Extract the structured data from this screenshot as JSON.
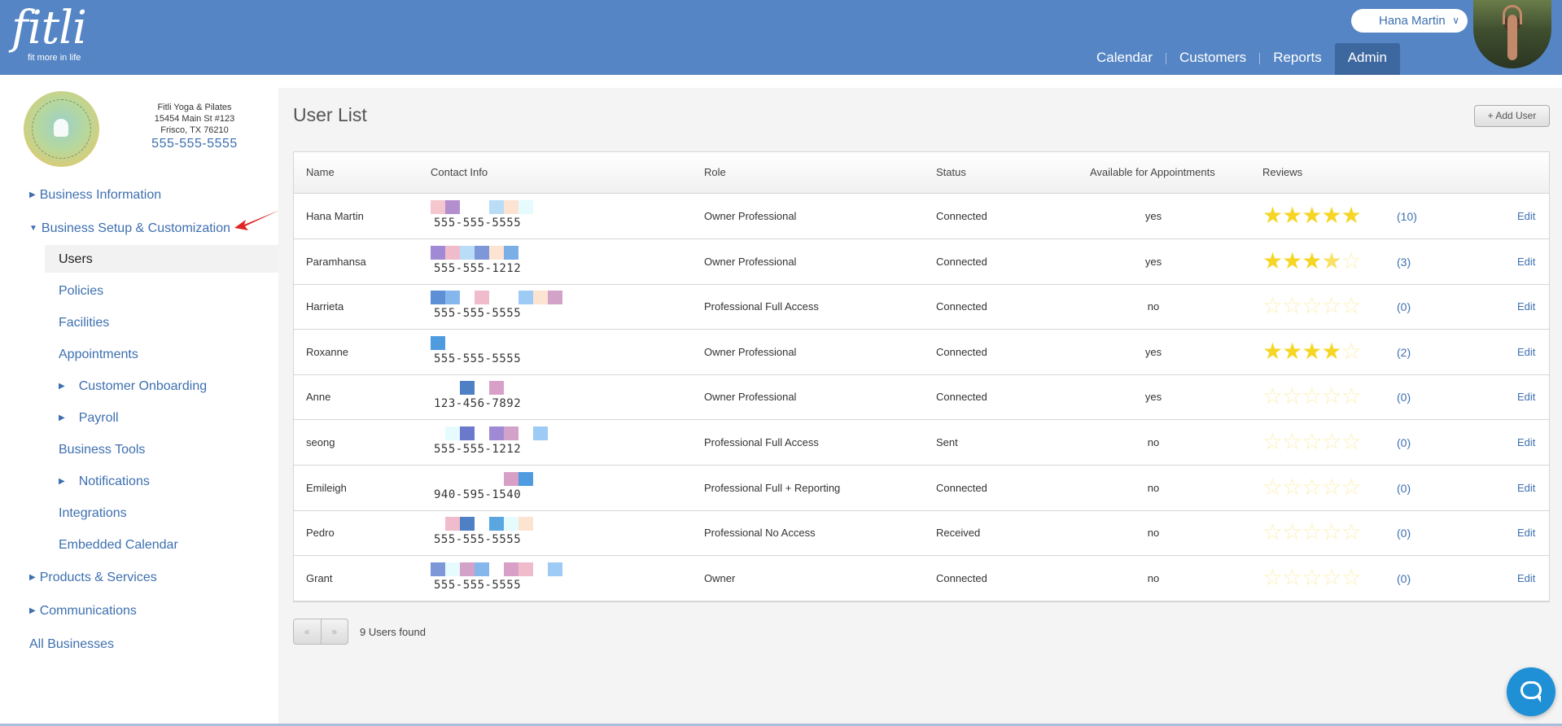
{
  "app": {
    "logo": "fitli",
    "tagline": "fit more in life"
  },
  "header": {
    "user_name": "Hana Martin",
    "nav": [
      {
        "label": "Calendar"
      },
      {
        "label": "Customers"
      },
      {
        "label": "Reports"
      },
      {
        "label": "Admin",
        "active": true
      }
    ]
  },
  "business": {
    "name": "Fitli Yoga & Pilates",
    "address1": "15454 Main St #123",
    "address2": "Frisco, TX 76210",
    "phone": "555-555-5555"
  },
  "sidebar": {
    "items": [
      {
        "label": "Business Information"
      },
      {
        "label": "Business Setup & Customization"
      },
      {
        "label": "Users"
      },
      {
        "label": "Policies"
      },
      {
        "label": "Facilities"
      },
      {
        "label": "Appointments"
      },
      {
        "label": "Customer Onboarding"
      },
      {
        "label": "Payroll"
      },
      {
        "label": "Business Tools"
      },
      {
        "label": "Notifications"
      },
      {
        "label": "Integrations"
      },
      {
        "label": "Embedded Calendar"
      },
      {
        "label": "Products & Services"
      },
      {
        "label": "Communications"
      },
      {
        "label": "All Businesses"
      }
    ]
  },
  "main": {
    "title": "User List",
    "add_button": "+ Add User",
    "columns": {
      "name": "Name",
      "contact": "Contact Info",
      "role": "Role",
      "status": "Status",
      "available": "Available for Appointments",
      "reviews": "Reviews"
    },
    "edit_label": "Edit",
    "rows": [
      {
        "name": "Hana Martin",
        "phone": "555-555-5555",
        "role": "Owner Professional",
        "status": "Connected",
        "available": "yes",
        "rating": 5,
        "review_count": "(10)"
      },
      {
        "name": "Paramhansa",
        "phone": "555-555-1212",
        "role": "Owner Professional",
        "status": "Connected",
        "available": "yes",
        "rating": 3.5,
        "review_count": "(3)"
      },
      {
        "name": "Harrieta",
        "phone": "555-555-5555",
        "role": "Professional Full Access",
        "status": "Connected",
        "available": "no",
        "rating": 0,
        "review_count": "(0)"
      },
      {
        "name": "Roxanne",
        "phone": "555-555-5555",
        "role": "Owner Professional",
        "status": "Connected",
        "available": "yes",
        "rating": 4,
        "review_count": "(2)"
      },
      {
        "name": "Anne",
        "phone": "123-456-7892",
        "role": "Owner Professional",
        "status": "Connected",
        "available": "yes",
        "rating": 0,
        "review_count": "(0)"
      },
      {
        "name": "seong",
        "phone": "555-555-1212",
        "role": "Professional Full Access",
        "status": "Sent",
        "available": "no",
        "rating": 0,
        "review_count": "(0)"
      },
      {
        "name": "Emileigh",
        "phone": "940-595-1540",
        "role": "Professional Full + Reporting",
        "status": "Connected",
        "available": "no",
        "rating": 0,
        "review_count": "(0)"
      },
      {
        "name": "Pedro",
        "phone": "555-555-5555",
        "role": "Professional No Access",
        "status": "Received",
        "available": "no",
        "rating": 0,
        "review_count": "(0)"
      },
      {
        "name": "Grant",
        "phone": "555-555-5555",
        "role": "Owner",
        "status": "Connected",
        "available": "no",
        "rating": 0,
        "review_count": "(0)"
      }
    ],
    "pager": {
      "prev": "«",
      "next": "»"
    },
    "found_text": "9 Users found"
  },
  "colors": {
    "header": "#5585c4",
    "accent": "#3d6fb0",
    "star": "#f6d525"
  }
}
